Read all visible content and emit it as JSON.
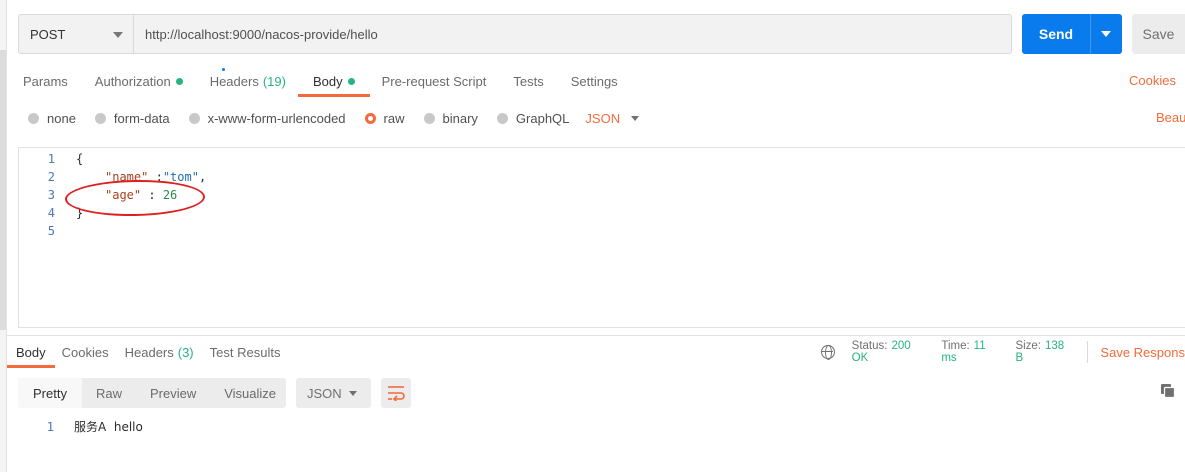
{
  "request": {
    "method": "POST",
    "url": "http://localhost:9000/nacos-provide/hello",
    "send_label": "Send",
    "save_label": "Save"
  },
  "request_tabs": [
    {
      "label": "Params"
    },
    {
      "label": "Authorization"
    },
    {
      "label": "Headers",
      "count": "(19)"
    },
    {
      "label": "Body"
    },
    {
      "label": "Pre-request Script"
    },
    {
      "label": "Tests"
    },
    {
      "label": "Settings"
    }
  ],
  "cookies_label": "Cookies",
  "beautify_label": "Beau",
  "body_types": [
    "none",
    "form-data",
    "x-www-form-urlencoded",
    "raw",
    "binary",
    "GraphQL"
  ],
  "body_lang": "JSON",
  "editor": {
    "lines": [
      {
        "n": "1",
        "text": "{"
      },
      {
        "n": "2",
        "key": "\"name\"",
        "sep": " :",
        "value": "\"tom\"",
        "tail": ","
      },
      {
        "n": "3",
        "key": "\"age\"",
        "sep": " : ",
        "value": "26",
        "tail": ""
      },
      {
        "n": "4",
        "text": "}"
      },
      {
        "n": "5",
        "text": ""
      }
    ]
  },
  "response_tabs": [
    {
      "label": "Body"
    },
    {
      "label": "Cookies"
    },
    {
      "label": "Headers",
      "count": "(3)"
    },
    {
      "label": "Test Results"
    }
  ],
  "status": {
    "status_label": "Status:",
    "status_value": "200 OK",
    "time_label": "Time:",
    "time_value": "11 ms",
    "size_label": "Size:",
    "size_value": "138 B",
    "save_response_label": "Save Respons"
  },
  "view_modes": [
    "Pretty",
    "Raw",
    "Preview",
    "Visualize"
  ],
  "response_format": "JSON",
  "response_body": {
    "n": "1",
    "text": "服务A  hello"
  },
  "colors": {
    "accent": "#f26b3a",
    "send": "#097bed",
    "success": "#26b47f",
    "annotation": "#e02020"
  }
}
